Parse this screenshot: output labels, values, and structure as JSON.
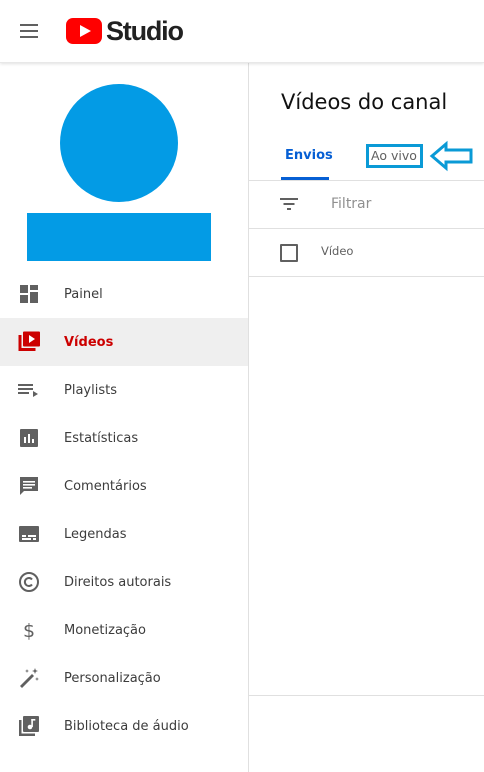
{
  "app": {
    "logo_text": "Studio",
    "brand_color": "#ff0000"
  },
  "topbar": {
    "menu_icon": "hamburger-menu-icon"
  },
  "sidebar": {
    "avatar_color": "#039be5",
    "items": [
      {
        "label": "Painel",
        "icon": "dashboard-icon",
        "active": false
      },
      {
        "label": "Vídeos",
        "icon": "videos-icon",
        "active": true
      },
      {
        "label": "Playlists",
        "icon": "playlists-icon",
        "active": false
      },
      {
        "label": "Estatísticas",
        "icon": "analytics-icon",
        "active": false
      },
      {
        "label": "Comentários",
        "icon": "comments-icon",
        "active": false
      },
      {
        "label": "Legendas",
        "icon": "subtitles-icon",
        "active": false
      },
      {
        "label": "Direitos autorais",
        "icon": "copyright-icon",
        "active": false
      },
      {
        "label": "Monetização",
        "icon": "dollar-icon",
        "active": false
      },
      {
        "label": "Personalização",
        "icon": "magic-wand-icon",
        "active": false
      },
      {
        "label": "Biblioteca de áudio",
        "icon": "audio-library-icon",
        "active": false
      }
    ],
    "active_color": "#cc0000"
  },
  "main": {
    "title": "Vídeos do canal",
    "tabs": [
      {
        "label": "Envios",
        "active": true
      },
      {
        "label": "Ao vivo",
        "active": false
      }
    ],
    "accent_color": "#065fd4",
    "annotation_color": "#0a9ad6",
    "filter": {
      "placeholder": "Filtrar",
      "value": ""
    },
    "table": {
      "columns": [
        "Vídeo"
      ]
    }
  }
}
